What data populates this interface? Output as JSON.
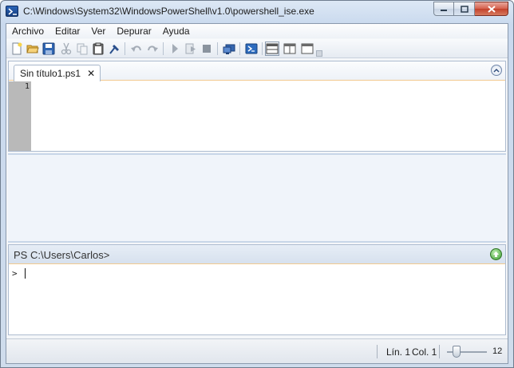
{
  "window": {
    "title": "C:\\Windows\\System32\\WindowsPowerShell\\v1.0\\powershell_ise.exe",
    "colors": {
      "title_bar": "#c9d9ee",
      "close_button": "#c3412b",
      "gutter": "#b9b9b9",
      "pane_accent": "#f2c98e"
    }
  },
  "menu": {
    "items": [
      "Archivo",
      "Editar",
      "Ver",
      "Depurar",
      "Ayuda"
    ]
  },
  "toolbar": {
    "icons": [
      "new-file-icon",
      "open-folder-icon",
      "save-icon",
      "cut-icon",
      "copy-icon",
      "paste-icon",
      "clear-icon",
      "undo-icon",
      "redo-icon",
      "run-icon",
      "run-selection-icon",
      "stop-icon",
      "remote-session-icon",
      "powershell-console-icon",
      "layout-top-icon",
      "layout-right-icon",
      "layout-maximized-icon"
    ]
  },
  "script_tab": {
    "label": "Sin título1.ps1",
    "close_glyph": "✕"
  },
  "editor": {
    "line_number": "1"
  },
  "command_pane": {
    "prompt": "PS C:\\Users\\Carlos>",
    "input_prompt": ">"
  },
  "status": {
    "line": "Lín. 1",
    "col": "Col. 1",
    "zoom": "12"
  }
}
